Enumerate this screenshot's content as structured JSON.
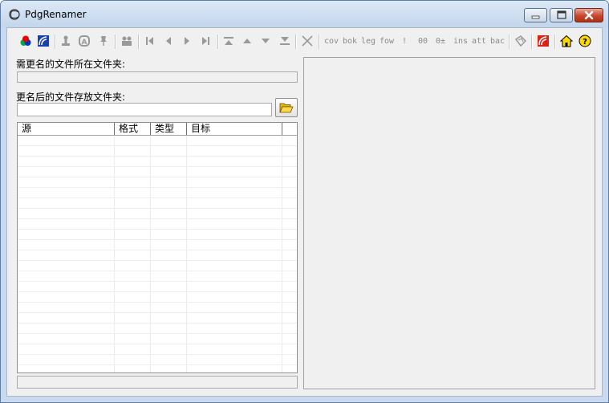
{
  "window": {
    "title": "PdgRenamer",
    "controls": [
      "minimize",
      "maximize",
      "close"
    ]
  },
  "toolbar": {
    "icons": [
      "rgb-circles-icon",
      "rainbow-bookmark-icon",
      "stamp-icon",
      "a-badge-icon",
      "pin-icon",
      "people-icon",
      "first-icon",
      "prev-icon",
      "next-icon",
      "last-icon",
      "top-icon",
      "up-icon",
      "down-icon",
      "bottom-icon",
      "delete-x-icon"
    ],
    "text_buttons": [
      "cov",
      "bok",
      "leg",
      "fow",
      "!",
      "00",
      "0±",
      "ins",
      "att",
      "bac"
    ],
    "right_icons": [
      "tag-icon",
      "red-rainbow-icon",
      "home-icon",
      "help-icon"
    ]
  },
  "source_folder": {
    "label": "需更名的文件所在文件夹:",
    "value": ""
  },
  "target_folder": {
    "label": "更名后的文件存放文件夹:",
    "value": ""
  },
  "file_list": {
    "columns": [
      "源",
      "格式",
      "类型",
      "目标"
    ],
    "rows": []
  },
  "status": {
    "text": ""
  }
}
